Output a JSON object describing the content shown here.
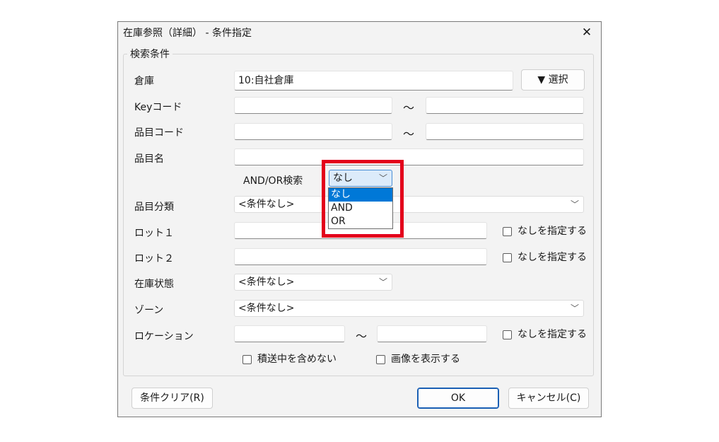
{
  "window": {
    "title": "在庫参照（詳細） - 条件指定",
    "close": "✕"
  },
  "group": {
    "title": "検索条件"
  },
  "warehouse": {
    "label": "倉庫",
    "value": "10:自社倉庫",
    "select_button": "▼ 選択"
  },
  "key_code": {
    "label": "Keyコード",
    "from": "",
    "to": "",
    "tilde": "～"
  },
  "item_code": {
    "label": "品目コード",
    "from": "",
    "to": "",
    "tilde": "～"
  },
  "item_name": {
    "label": "品目名",
    "value": ""
  },
  "and_or": {
    "label": "AND/OR検索",
    "selected": "なし",
    "options": [
      "なし",
      "AND",
      "OR"
    ]
  },
  "item_category": {
    "label": "品目分類",
    "value": "<条件なし>"
  },
  "lot1": {
    "label": "ロット１",
    "value": "",
    "none_label": "なしを指定する"
  },
  "lot2": {
    "label": "ロット２",
    "value": "",
    "none_label": "なしを指定する"
  },
  "stock_status": {
    "label": "在庫状態",
    "value": "<条件なし>"
  },
  "zone": {
    "label": "ゾーン",
    "value": "<条件なし>"
  },
  "location": {
    "label": "ロケーション",
    "from": "",
    "to": "",
    "tilde": "～",
    "none_label": "なしを指定する"
  },
  "options": {
    "exclude_in_transit": "積送中を含めない",
    "show_image": "画像を表示する"
  },
  "buttons": {
    "clear": "条件クリア(R)",
    "ok": "OK",
    "cancel": "キャンセル(C)"
  },
  "colors": {
    "highlight": "#e3001b",
    "selection": "#0078d7",
    "accent": "#1a5fb4"
  }
}
